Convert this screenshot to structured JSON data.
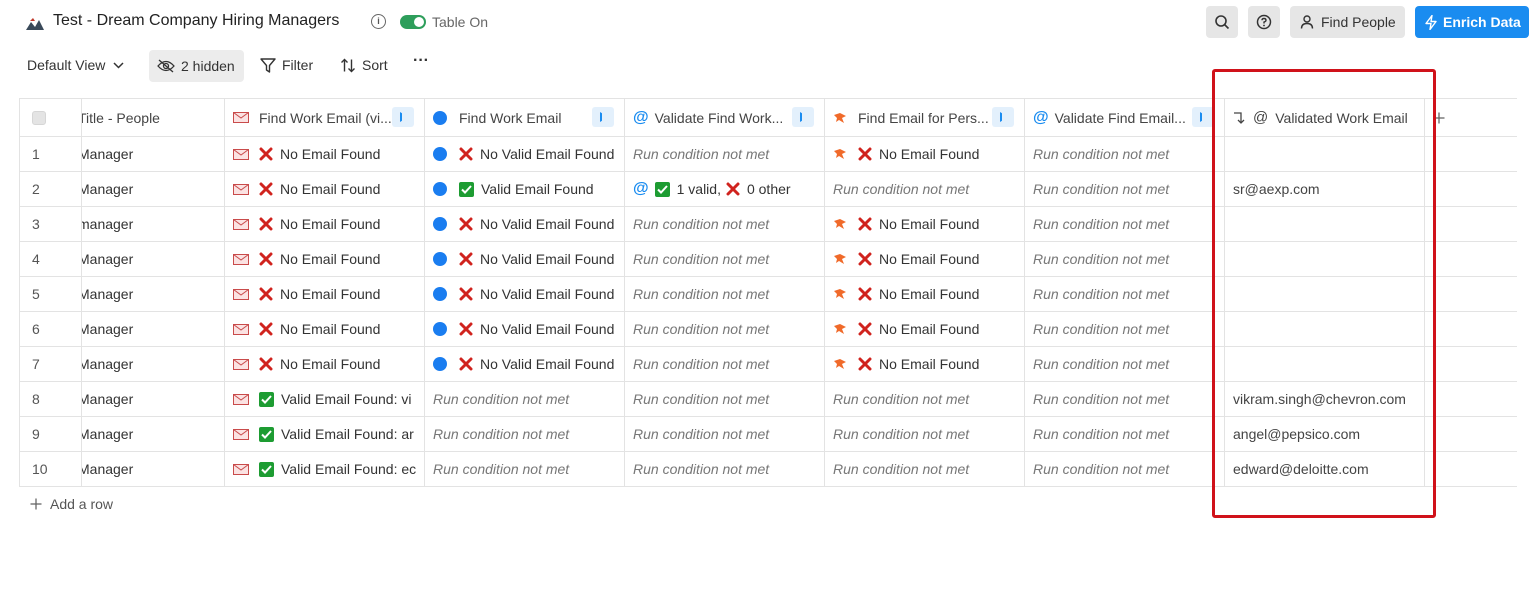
{
  "header": {
    "title": "Test - Dream Company Hiring Managers",
    "toggle_label": "Table On",
    "find_people": "Find People",
    "enrich_data": "Enrich Data",
    "accent_color": "#1a8cf0"
  },
  "toolbar": {
    "view": "Default View",
    "hidden": "2 hidden",
    "filter": "Filter",
    "sort": "Sort",
    "more": "···"
  },
  "table": {
    "columns": [
      {
        "label": "Title - People",
        "icon": "none"
      },
      {
        "label": "Find Work Email (vi...",
        "icon": "envelope-icon"
      },
      {
        "label": "Find Work Email",
        "icon": "blue-circle-icon"
      },
      {
        "label": "Validate Find Work...",
        "icon": "at-icon"
      },
      {
        "label": "Find Email for Pers...",
        "icon": "fox-icon"
      },
      {
        "label": "Validate Find Email...",
        "icon": "at-icon"
      },
      {
        "label": "Validated Work Email",
        "icon": "merge-at-icon"
      }
    ],
    "rows": [
      {
        "num": "1",
        "title": "Manager",
        "c1": "No Email Found",
        "c2": "No Valid Email Found",
        "c3": "Run condition not met",
        "c4": "No Email Found",
        "c5": "Run condition not met",
        "c6": ""
      },
      {
        "num": "2",
        "title": "Manager",
        "c1": "No Email Found",
        "c2": "Valid Email Found",
        "c3a": "1 valid,",
        "c3b": "0 other",
        "c4": "Run condition not met",
        "c5": "Run condition not met",
        "c6": "sr@aexp.com"
      },
      {
        "num": "3",
        "title": "manager",
        "c1": "No Email Found",
        "c2": "No Valid Email Found",
        "c3": "Run condition not met",
        "c4": "No Email Found",
        "c5": "Run condition not met",
        "c6": ""
      },
      {
        "num": "4",
        "title": "Manager",
        "c1": "No Email Found",
        "c2": "No Valid Email Found",
        "c3": "Run condition not met",
        "c4": "No Email Found",
        "c5": "Run condition not met",
        "c6": ""
      },
      {
        "num": "5",
        "title": "Manager",
        "c1": "No Email Found",
        "c2": "No Valid Email Found",
        "c3": "Run condition not met",
        "c4": "No Email Found",
        "c5": "Run condition not met",
        "c6": ""
      },
      {
        "num": "6",
        "title": "Manager",
        "c1": "No Email Found",
        "c2": "No Valid Email Found",
        "c3": "Run condition not met",
        "c4": "No Email Found",
        "c5": "Run condition not met",
        "c6": ""
      },
      {
        "num": "7",
        "title": "Manager",
        "c1": "No Email Found",
        "c2": "No Valid Email Found",
        "c3": "Run condition not met",
        "c4": "No Email Found",
        "c5": "Run condition not met",
        "c6": ""
      },
      {
        "num": "8",
        "title": "Manager",
        "c1": "Valid Email Found: vi",
        "c2": "Run condition not met",
        "c3": "Run condition not met",
        "c4": "Run condition not met",
        "c5": "Run condition not met",
        "c6": "vikram.singh@chevron.com"
      },
      {
        "num": "9",
        "title": "Manager",
        "c1": "Valid Email Found: ar",
        "c2": "Run condition not met",
        "c3": "Run condition not met",
        "c4": "Run condition not met",
        "c5": "Run condition not met",
        "c6": "angel@pepsico.com"
      },
      {
        "num": "10",
        "title": "Manager",
        "c1": "Valid Email Found: ec",
        "c2": "Run condition not met",
        "c3": "Run condition not met",
        "c4": "Run condition not met",
        "c5": "Run condition not met",
        "c6": "edward@deloitte.com"
      }
    ]
  },
  "add_row": "Add a row",
  "highlight_color": "#d0121a"
}
